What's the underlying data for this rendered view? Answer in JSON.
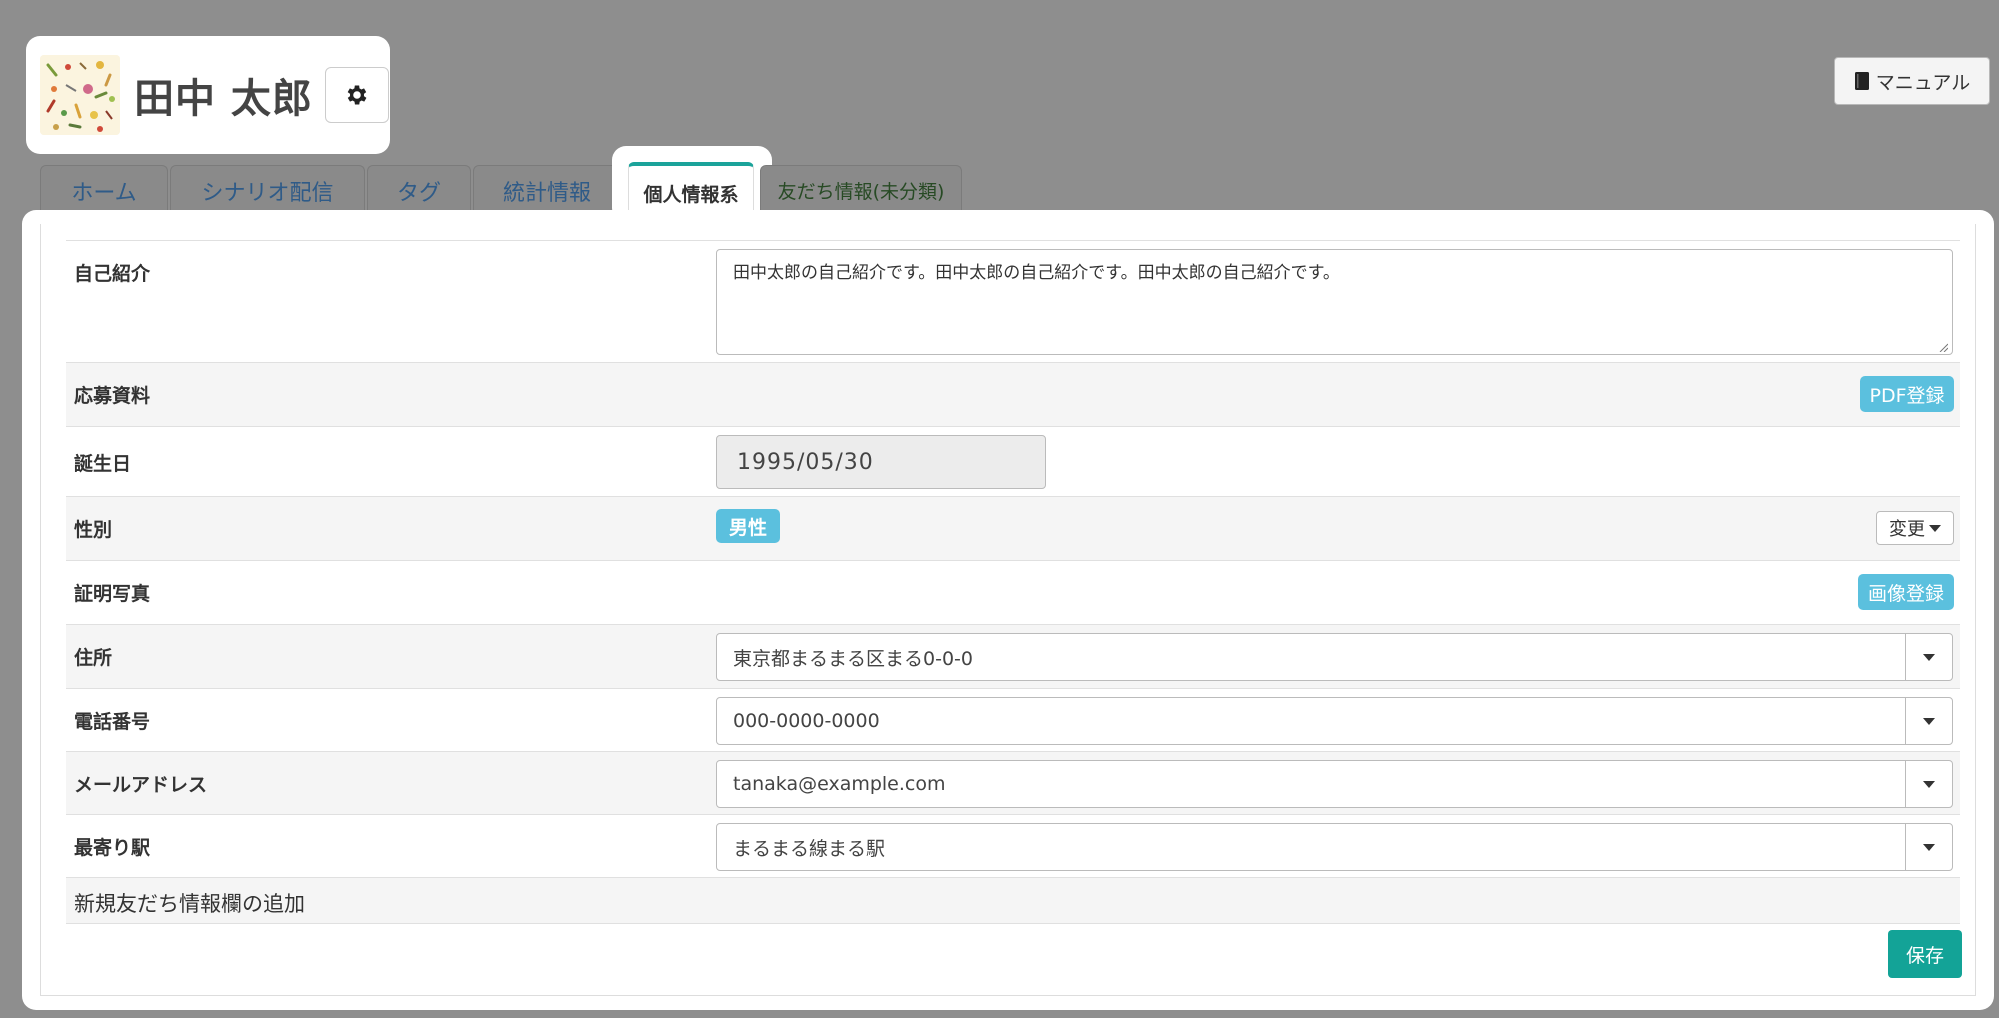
{
  "header": {
    "user_name": "田中 太郎",
    "manual_label": "マニュアル"
  },
  "tabs": [
    {
      "label": "ホーム"
    },
    {
      "label": "シナリオ配信"
    },
    {
      "label": "タグ"
    },
    {
      "label": "統計情報"
    },
    {
      "label": "個人情報系",
      "active": true
    },
    {
      "label": "友だち情報(未分類)"
    }
  ],
  "fields": {
    "intro": {
      "label": "自己紹介",
      "value": "田中太郎の自己紹介です。田中太郎の自己紹介です。田中太郎の自己紹介です。"
    },
    "application": {
      "label": "応募資料",
      "button": "PDF登録"
    },
    "birthday": {
      "label": "誕生日",
      "value": "1995/05/30"
    },
    "gender": {
      "label": "性別",
      "value": "男性",
      "change_label": "変更"
    },
    "photo": {
      "label": "証明写真",
      "button": "画像登録"
    },
    "address": {
      "label": "住所",
      "value": "東京都まるまる区まる0-0-0"
    },
    "phone": {
      "label": "電話番号",
      "value": "000-0000-0000"
    },
    "email": {
      "label": "メールアドレス",
      "value": "tanaka@example.com"
    },
    "station": {
      "label": "最寄り駅",
      "value": "まるまる線まる駅"
    }
  },
  "add_field_label": "新規友だち情報欄の追加",
  "save_label": "保存",
  "colors": {
    "accent": "#13a397",
    "info": "#5bc0de",
    "tab_active_border": "#1ba39a"
  }
}
